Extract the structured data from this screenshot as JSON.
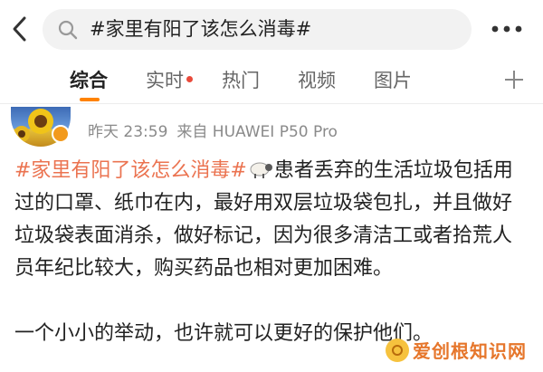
{
  "search": {
    "query": "#家里有阳了该怎么消毒#"
  },
  "tabs": [
    {
      "label": "综合"
    },
    {
      "label": "实时"
    },
    {
      "label": "热门"
    },
    {
      "label": "视频"
    },
    {
      "label": "图片"
    }
  ],
  "post": {
    "time": "昨天 23:59",
    "source": "来自 HUAWEI P50 Pro",
    "hashtag": "#家里有阳了该怎么消毒#",
    "paragraph1_after_emoji": "患者丢弃的生活垃圾包括用过的口罩、纸巾在内，最好用双层垃圾袋包扎，并且做好垃圾袋表面消杀，做好标记，因为很多清洁工或者拾荒人员年纪比较大，购买药品也相对更加困难。",
    "paragraph2": "一个小小的举动，也许就可以更好的保护他们。"
  },
  "colors": {
    "accent": "#ff8200",
    "hashtag": "#eb7350",
    "unread_dot": "#e94a3b"
  },
  "icons": {
    "back": "chevron-left-icon",
    "search": "search-icon",
    "more": "more-dots-icon",
    "add_tab": "plus-icon",
    "emoji": "sheep-emoji-icon",
    "verified": "verified-badge-icon"
  },
  "watermark": {
    "text": "爱创根知识网"
  }
}
